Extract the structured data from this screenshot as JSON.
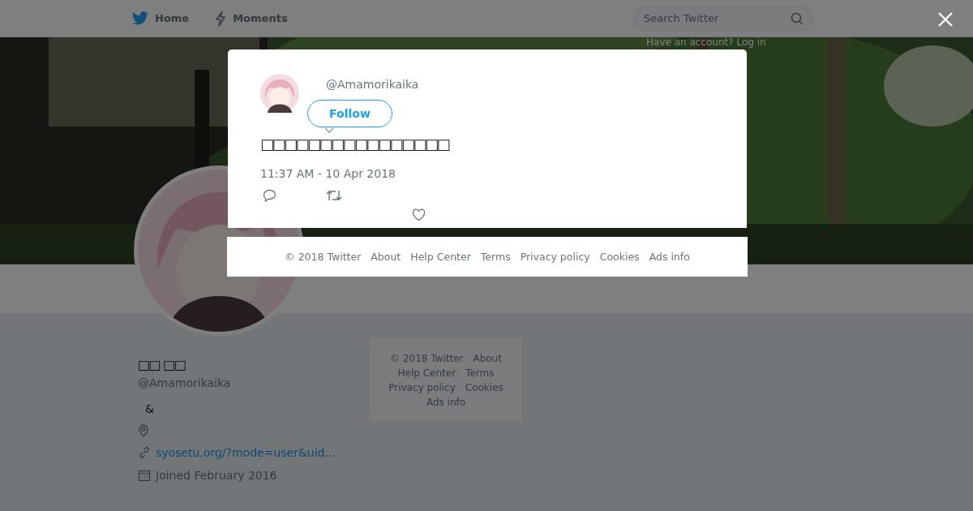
{
  "top_nav": {
    "items": [
      {
        "label": "Home",
        "kind": "bird"
      },
      {
        "label": "Moments",
        "kind": "bolt"
      }
    ],
    "search": {
      "placeholder": "Search Twitter"
    },
    "login_prompt": "Have an account? Log in"
  },
  "profile": {
    "name": "□□ □□",
    "handle": "@Amamorikaika",
    "bio": "&",
    "link": "syosetu.org/?mode=user&uid...",
    "joined": "Joined February 2016"
  },
  "side_footer": {
    "links": [
      "© 2018 Twitter",
      "About",
      "Help Center",
      "Terms",
      "Privacy policy",
      "Cookies",
      "Ads info"
    ]
  },
  "tweet_modal": {
    "handle": "@Amamorikaika",
    "follow_button": "Follow",
    "text": "□□□□□□□□□□□□□□□□",
    "timestamp": "11:37 AM - 10 Apr 2018"
  },
  "modal_footer": {
    "links": [
      "© 2018 Twitter",
      "About",
      "Help Center",
      "Terms",
      "Privacy policy",
      "Cookies",
      "Ads info"
    ]
  }
}
